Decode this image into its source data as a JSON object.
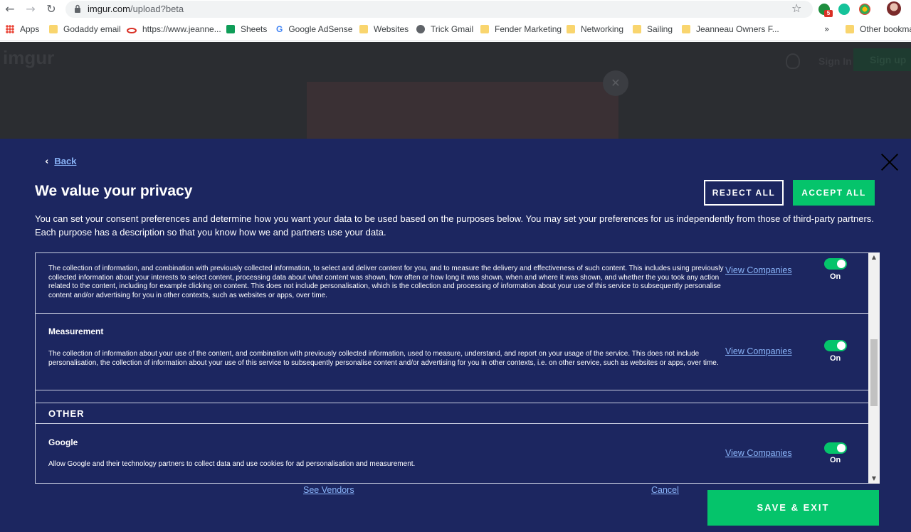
{
  "browser": {
    "url_domain": "imgur.com",
    "url_path": "/upload?beta",
    "extension_badge": "5",
    "bookmarks": [
      {
        "label": "Apps",
        "icon": "apps-grid-icon"
      },
      {
        "label": "Godaddy email",
        "icon": "folder-icon"
      },
      {
        "label": "https://www.jeanne...",
        "icon": "site-icon"
      },
      {
        "label": "Sheets",
        "icon": "sheets-icon"
      },
      {
        "label": "Google AdSense",
        "icon": "google-icon"
      },
      {
        "label": "Websites",
        "icon": "folder-icon"
      },
      {
        "label": "Trick Gmail",
        "icon": "globe-icon"
      },
      {
        "label": "Fender Marketing",
        "icon": "folder-icon"
      },
      {
        "label": "Networking",
        "icon": "folder-icon"
      },
      {
        "label": "Sailing",
        "icon": "folder-icon"
      },
      {
        "label": "Jeanneau Owners F...",
        "icon": "folder-icon"
      },
      {
        "label": "Other bookmarks",
        "icon": "folder-icon"
      }
    ],
    "overflow_label": "»"
  },
  "background_page": {
    "logo": "imgur",
    "sign_in": "Sign In",
    "sign_up": "Sign up"
  },
  "privacy": {
    "back_label": "Back",
    "title": "We value your privacy",
    "reject_all": "REJECT ALL",
    "accept_all": "ACCEPT ALL",
    "description": "You can set your consent preferences and determine how you want your data to be used based on the purposes below. You may set your preferences for us independently from those of third-party partners. Each purpose has a description so that you know how we and partners use your data.",
    "purposes": [
      {
        "title": "",
        "text": "The collection of information, and combination with previously collected information, to select and deliver content for you, and to measure the delivery and effectiveness of such content. This includes using previously collected information about your interests to select content, processing data about what content was shown, how often or how long it was shown, when and where it was shown, and whether the you took any action related to the content, including for example clicking on content. This does not include personalisation, which is the collection and processing of information about your use of this service to subsequently personalise content and/or advertising for you in other contexts, such as websites or apps, over time.",
        "view_companies": "View Companies",
        "toggle_state": "On"
      },
      {
        "title": "Measurement",
        "text": "The collection of information about your use of the content, and combination with previously collected information, used to measure, understand, and report on your usage of the service. This does not include personalisation, the collection of information about your use of this service to subsequently personalise content and/or advertising for you in other contexts, i.e. on other service, such as websites or apps, over time.",
        "view_companies": "View Companies",
        "toggle_state": "On"
      }
    ],
    "other_heading": "OTHER",
    "other_items": [
      {
        "title": "Google",
        "text": "Allow Google and their technology partners to collect data and use cookies for ad personalisation and measurement.",
        "view_companies": "View Companies",
        "toggle_state": "On"
      }
    ],
    "see_vendors": "See Vendors",
    "cancel": "Cancel",
    "save_exit": "SAVE & EXIT",
    "colors": {
      "overlay_bg": "#1c2660",
      "accent_green": "#05c46b",
      "link_blue": "#8ab4f8"
    }
  }
}
